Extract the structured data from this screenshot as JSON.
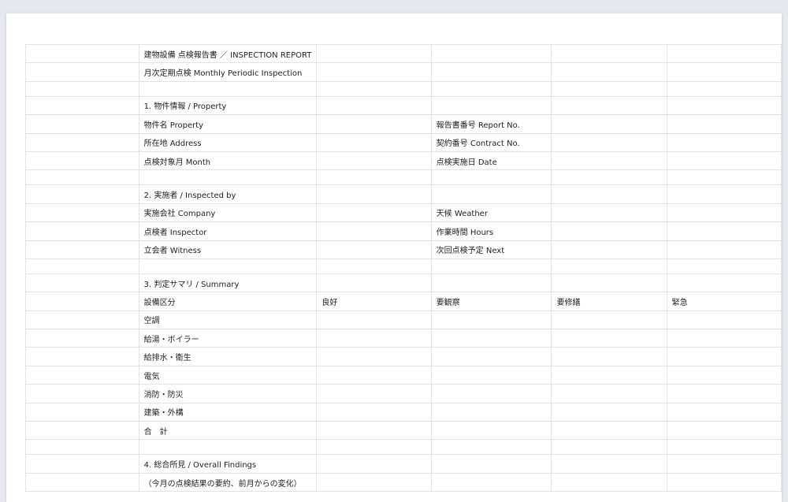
{
  "title": "建物設備 点検報告書 ／ INSPECTION REPORT",
  "subtitle": "月次定期点検 Monthly Periodic Inspection",
  "sections": {
    "property": {
      "heading": "1. 物件情報 / Property",
      "rows": [
        {
          "left": "物件名 Property",
          "right": "報告書番号 Report No."
        },
        {
          "left": "所在地 Address",
          "right": "契約番号 Contract No."
        },
        {
          "left": "点検対象月 Month",
          "right": "点検実施日 Date"
        }
      ]
    },
    "inspected": {
      "heading": "2. 実施者 / Inspected by",
      "rows": [
        {
          "left": "実施会社 Company",
          "right": "天候 Weather"
        },
        {
          "left": "点検者 Inspector",
          "right": "作業時間 Hours"
        },
        {
          "left": "立会者 Witness",
          "right": "次回点検予定 Next"
        }
      ]
    },
    "summary": {
      "heading": "3. 判定サマリ / Summary",
      "header": [
        "設備区分",
        "良好",
        "要観察",
        "要修繕",
        "緊急"
      ],
      "rows": [
        "空調",
        "給湯・ボイラー",
        "給排水・衛生",
        "電気",
        "消防・防災",
        "建築・外構",
        "合　計"
      ]
    },
    "findings": {
      "heading": "4. 総合所見 / Overall Findings",
      "note": "（今月の点検結果の要約、前月からの変化）"
    }
  }
}
